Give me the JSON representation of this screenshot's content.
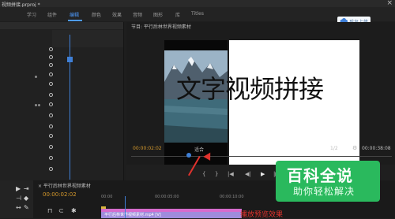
{
  "window": {
    "title": "视频拼接.prproj *",
    "close_glyph": "×"
  },
  "menu": {
    "items": [
      "学习",
      "组件",
      "编辑",
      "颜色",
      "效果",
      "音频",
      "图形",
      "库",
      "Titles"
    ],
    "active_index": 2,
    "upload_button": "后台上传"
  },
  "monitor": {
    "tab_label": "节目: 平行后林世界视频素材",
    "overlay_text": "文字视频拼接",
    "timecode_current": "00:00:02:02",
    "fit_label": "适合",
    "page_indicator": "1/2",
    "timecode_duration": "00:00:38:08"
  },
  "timeline": {
    "tab_label": "× 平行后林世界视频素材",
    "timecode": "00:00:02:02",
    "ruler_marks": [
      "00:00",
      "00:00:05:00",
      "00:00:10:00"
    ],
    "clip_label": "平行后林世界视频素材.mp4 [V]",
    "annotation": "播放预览效果"
  },
  "watermark": {
    "main": "百科全说",
    "sub": "助你轻松解决"
  },
  "colors": {
    "accent_blue": "#3f7fd6",
    "timecode_orange": "#d79a2c",
    "annotation_red": "#e0322d",
    "clip_pink": "#d66ccd",
    "clip_purple": "#9f8cdc",
    "logo_green": "#2ab95d"
  }
}
